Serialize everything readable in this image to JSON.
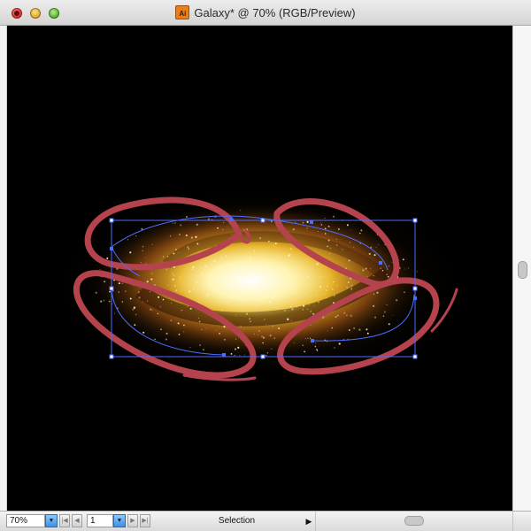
{
  "window": {
    "title": "Galaxy* @ 70% (RGB/Preview)",
    "doc_icon_label": "Ai",
    "doc_icon_name": "illustrator-document-icon"
  },
  "status_bar": {
    "zoom_value": "70%",
    "page_value": "1",
    "status_text": "Selection",
    "dropdown_glyph": "▼",
    "first_glyph": "|◀",
    "prev_glyph": "◀",
    "next_glyph": "▶",
    "last_glyph": "▶|",
    "status_menu_glyph": "▶"
  },
  "colors": {
    "canvas_background": "#000000",
    "stroke_red": "#b5434e",
    "selection_blue": "#4d6dff",
    "galaxy_core": "#fff6b0",
    "galaxy_mid": "#e0a21a",
    "galaxy_outer": "#7a3a0a"
  }
}
